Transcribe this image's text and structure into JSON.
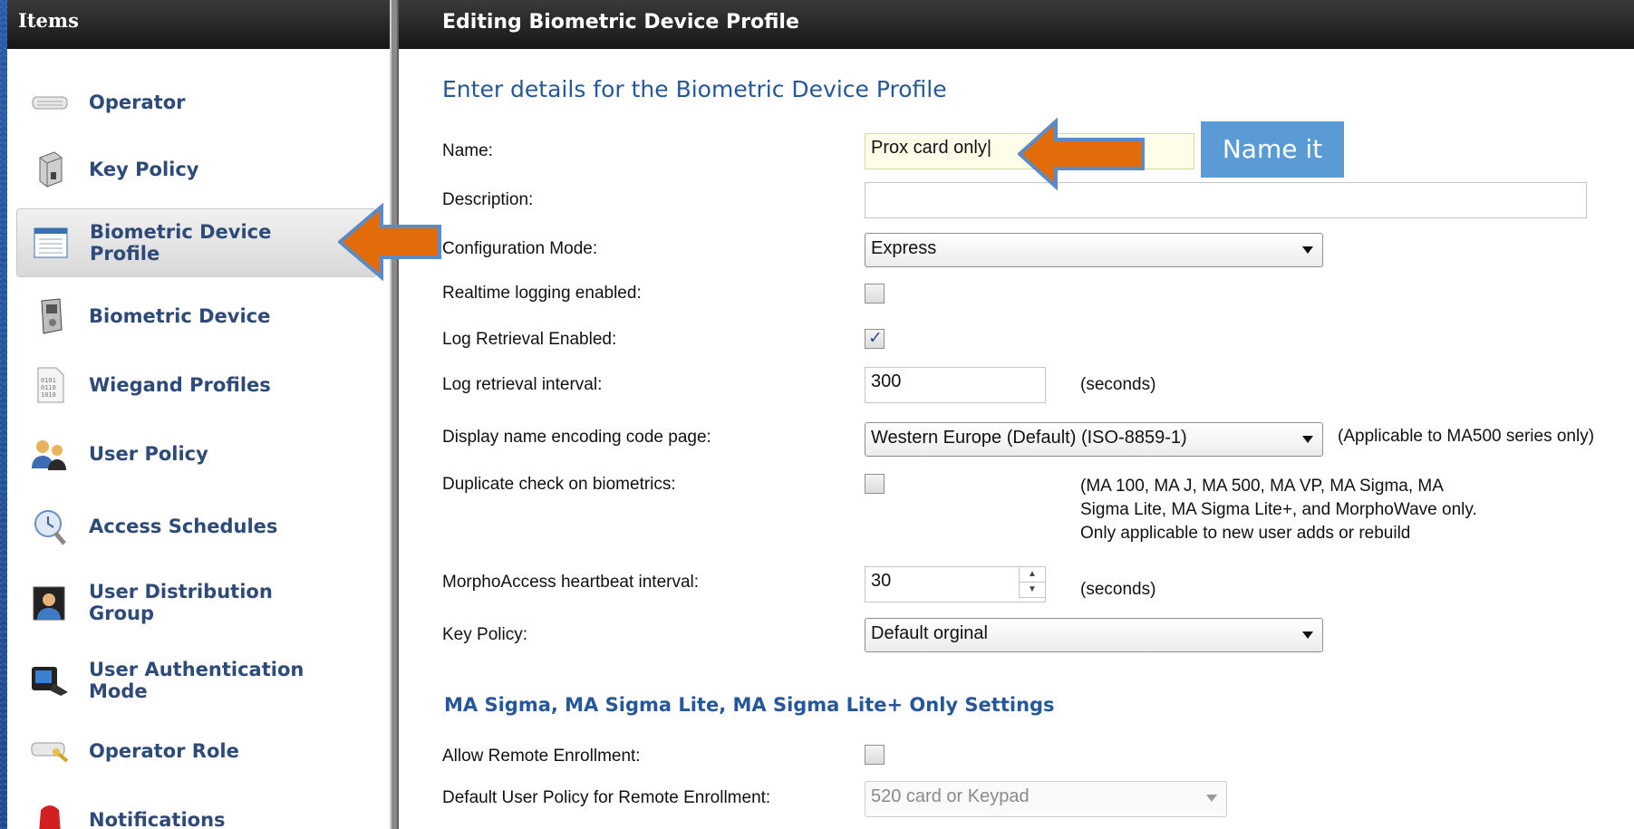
{
  "left_panel": {
    "header": "Items",
    "items": [
      {
        "label": "Operator",
        "icon": "keyboard-icon"
      },
      {
        "label": "Key Policy",
        "icon": "key-box-icon"
      },
      {
        "label": "Biometric Device\nProfile",
        "icon": "profile-list-icon"
      },
      {
        "label": "Biometric Device",
        "icon": "device-icon"
      },
      {
        "label": "Wiegand Profiles",
        "icon": "binary-doc-icon"
      },
      {
        "label": "User Policy",
        "icon": "users-icon"
      },
      {
        "label": "Access Schedules",
        "icon": "clock-search-icon"
      },
      {
        "label": "User Distribution\nGroup",
        "icon": "user-photo-icon"
      },
      {
        "label": "User Authentication\nMode",
        "icon": "fingerprint-device-icon"
      },
      {
        "label": "Operator Role",
        "icon": "keyboard-key-icon"
      },
      {
        "label": "Notifications",
        "icon": "alarm-icon"
      }
    ]
  },
  "right_panel": {
    "header": "Editing Biometric Device Profile",
    "section_title": "Enter details for the Biometric Device Profile",
    "fields": {
      "name": {
        "label": "Name:",
        "value": "Prox card only|"
      },
      "description": {
        "label": "Description:",
        "value": ""
      },
      "configuration_mode": {
        "label": "Configuration Mode:",
        "value": "Express"
      },
      "realtime_logging": {
        "label": "Realtime logging enabled:",
        "checked": false
      },
      "log_retrieval": {
        "label": "Log Retrieval Enabled:",
        "checked": true
      },
      "log_interval": {
        "label": "Log retrieval interval:",
        "value": "300",
        "unit": "(seconds)"
      },
      "encoding": {
        "label": "Display name encoding code page:",
        "value": "Western Europe (Default) (ISO-8859-1)",
        "note": "(Applicable to MA500 series only)"
      },
      "duplicate_check": {
        "label": "Duplicate check on biometrics:",
        "checked": false,
        "note_lines": [
          "(MA 100, MA J, MA 500, MA VP, MA Sigma, MA",
          "Sigma Lite, MA Sigma Lite+, and MorphoWave only.",
          "Only applicable to new user adds or rebuild"
        ]
      },
      "heartbeat": {
        "label": "MorphoAccess heartbeat interval:",
        "value": "30",
        "unit": "(seconds)"
      },
      "key_policy": {
        "label": "Key Policy:",
        "value": "Default orginal"
      }
    },
    "subsection_title": "MA Sigma, MA Sigma Lite, MA Sigma Lite+ Only Settings",
    "sigma_fields": {
      "allow_remote": {
        "label": "Allow Remote Enrollment:",
        "checked": false
      },
      "default_policy": {
        "label": "Default User Policy for Remote Enrollment:",
        "value": "520 card or Keypad"
      }
    }
  },
  "annotations": {
    "callout_text": "Name it",
    "callout_color": "#5b9bd5",
    "arrow_color": "#e36c0a"
  }
}
